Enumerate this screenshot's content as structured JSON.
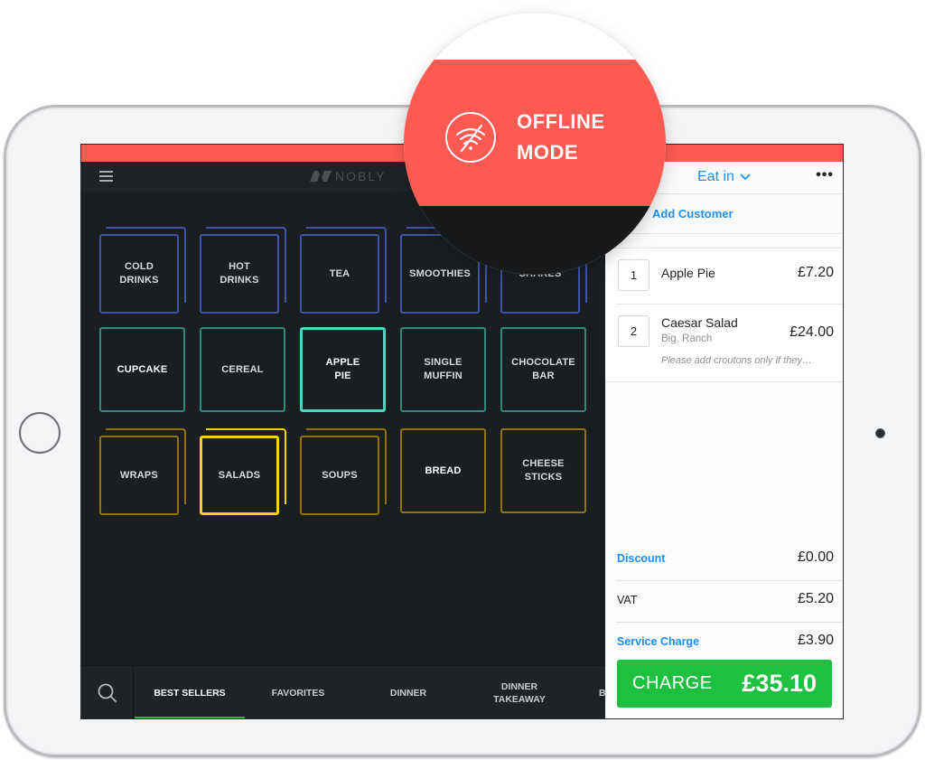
{
  "banner": {
    "status_title_line1": "OFFLINE",
    "status_title_line2": "MODE",
    "icon": "wifi-off-icon",
    "color": "#fd5a52"
  },
  "topbar": {
    "menu_icon": "hamburger-icon",
    "brand": "NOBLY"
  },
  "tiles": [
    {
      "label": "COLD DRINKS",
      "group": "drinks",
      "color": "#3c55a8",
      "stacked": true
    },
    {
      "label": "HOT DRINKS",
      "group": "drinks",
      "color": "#3c55a8",
      "stacked": true
    },
    {
      "label": "TEA",
      "group": "drinks",
      "color": "#3c55a8",
      "stacked": true
    },
    {
      "label": "SMOOTHIES",
      "group": "drinks",
      "color": "#3c55a8",
      "stacked": true
    },
    {
      "label": "SHAKES",
      "group": "drinks",
      "color": "#3c55a8",
      "stacked": true
    },
    {
      "label": "CUPCAKE",
      "group": "bakery",
      "color": "#2e8b79",
      "stacked": false
    },
    {
      "label": "CEREAL",
      "group": "bakery",
      "color": "#2e8b79",
      "stacked": false
    },
    {
      "label": "APPLE PIE",
      "group": "bakery",
      "color": "#49d6c1",
      "stacked": false,
      "selected": true
    },
    {
      "label": "SINGLE MUFFIN",
      "group": "bakery",
      "color": "#2e8b79",
      "stacked": false
    },
    {
      "label": "CHOCOLATE BAR",
      "group": "bakery",
      "color": "#2e8b79",
      "stacked": false
    },
    {
      "label": "WRAPS",
      "group": "lunch",
      "color": "#8e7512",
      "stacked": true
    },
    {
      "label": "SALADS",
      "group": "lunch",
      "color": "#fcd200",
      "stacked": true,
      "selected": true
    },
    {
      "label": "SOUPS",
      "group": "lunch",
      "color": "#8e7512",
      "stacked": true
    },
    {
      "label": "BREAD",
      "group": "lunch",
      "color": "#8e7512",
      "stacked": false
    },
    {
      "label": "CHEESE STICKS",
      "group": "lunch",
      "color": "#8e7512",
      "stacked": false
    }
  ],
  "bottom_nav": {
    "search_icon": "search-icon",
    "tabs": [
      {
        "label": "BEST SELLERS",
        "active": true
      },
      {
        "label": "FAVORITES"
      },
      {
        "label": "DINNER"
      },
      {
        "label": "DINNER TAKEAWAY"
      },
      {
        "label": "B"
      }
    ],
    "active_color": "#1ec13f"
  },
  "order": {
    "order_type": "Eat in",
    "more_label": "•••",
    "add_customer": "Add Customer",
    "items": [
      {
        "qty": "1",
        "name": "Apple Pie",
        "mods": "",
        "note": "",
        "price": "£7.20"
      },
      {
        "qty": "2",
        "name": "Caesar Salad",
        "mods": "Big, Ranch",
        "note": "Please add croutons only if they…",
        "price": "£24.00"
      }
    ],
    "totals": [
      {
        "label": "Discount",
        "value": "£0.00",
        "link": true
      },
      {
        "label": "VAT",
        "value": "£5.20",
        "link": false
      },
      {
        "label": "Service Charge",
        "value": "£3.90",
        "link": true
      }
    ],
    "charge_label": "CHARGE",
    "charge_total": "£35.10",
    "accent_color": "#1f8ef1",
    "charge_color": "#1ec13f"
  }
}
